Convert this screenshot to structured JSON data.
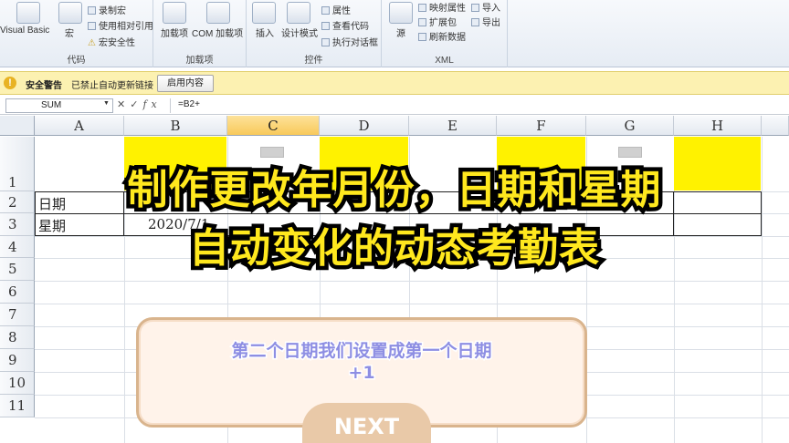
{
  "ribbon": {
    "code_group": {
      "label": "代码",
      "visual_basic": "Visual Basic",
      "macros": "宏",
      "record_macro": "录制宏",
      "relative_ref": "使用相对引用",
      "macro_security": "宏安全性"
    },
    "addins_group": {
      "label": "加载项",
      "addins": "加载项",
      "com_addins": "COM 加载项"
    },
    "controls_group": {
      "label": "控件",
      "insert": "插入",
      "design_mode": "设计模式",
      "properties": "属性",
      "view_code": "查看代码",
      "run_dialog": "执行对话框"
    },
    "xml_group": {
      "label": "XML",
      "source": "源",
      "map_props": "映射属性",
      "expansion": "扩展包",
      "refresh": "刷新数据",
      "import": "导入",
      "export": "导出"
    }
  },
  "security_bar": {
    "title": "安全警告",
    "message": "已禁止自动更新链接",
    "button": "启用内容"
  },
  "formula_bar": {
    "name_box": "SUM",
    "formula": "=B2+"
  },
  "columns": [
    "A",
    "B",
    "C",
    "D",
    "E",
    "F",
    "G",
    "H"
  ],
  "selected_column": "C",
  "rows": [
    "1",
    "2",
    "3",
    "4",
    "5",
    "6",
    "7",
    "8",
    "9",
    "10",
    "11"
  ],
  "cells": {
    "a2": "日期",
    "a3": "星期",
    "b3": "2020/7/1"
  },
  "colors": {
    "highlight": "#fff200",
    "title_text": "#ffe81e",
    "card_text": "#8d8ee3",
    "next_button": "#e9c9a8"
  },
  "overlay": {
    "title_line1": "制作更改年月份，日期和星期",
    "title_line2": "自动变化的动态考勤表",
    "card_line1": "第二个日期我们设置成第一个日期",
    "card_line2": "+1",
    "next_button": "NEXT"
  }
}
